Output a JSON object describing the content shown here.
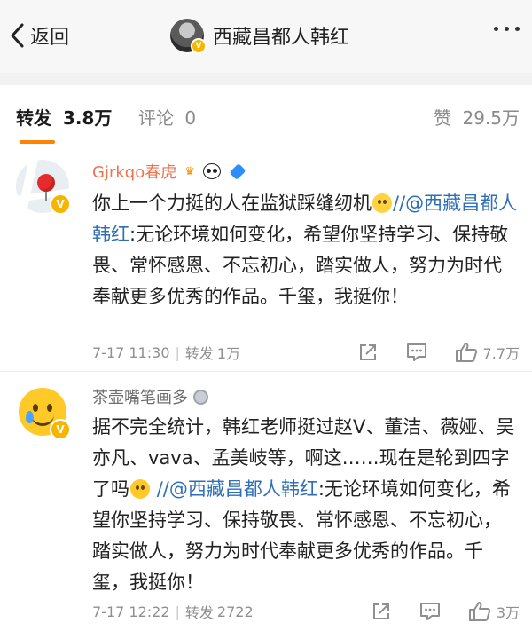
{
  "nav": {
    "back_label": "返回",
    "title": "西藏昌都人韩红"
  },
  "tabs": {
    "repost_label": "转发",
    "repost_count": "3.8万",
    "comment_label": "评论",
    "comment_count": "0",
    "like_label": "赞",
    "like_count": "29.5万"
  },
  "reposts": [
    {
      "username": "Gjrkqo春虎",
      "text_before": "你上一个力挺的人在监狱踩缝纫机",
      "mention": "//@西藏昌都人韩红",
      "text_after": ":无论环境如何变化，希望你坚持学习、保持敬畏、常怀感恩、不忘初心，踏实做人，努力为时代奉献更多优秀的作品。千玺，我挺你！",
      "time": "7-17 11:30",
      "repost_label": "转发",
      "repost_count": "1万",
      "like_count": "7.7万"
    },
    {
      "username": "茶壶嘴笔画多",
      "text_before": "据不完全统计，韩红老师挺过赵V、董洁、薇娅、吴亦凡、vava、孟美岐等，啊这……现在是轮到四字了吗",
      "mention": "//@西藏昌都人韩红",
      "text_after": ":无论环境如何变化，希望你坚持学习、保持敬畏、常怀感恩、不忘初心，踏实做人，努力为时代奉献更多优秀的作品。千玺，我挺你！",
      "time": "7-17 12:22",
      "repost_label": "转发",
      "repost_count": "2722",
      "like_count": "3万"
    }
  ],
  "colors": {
    "accent_orange": "#ff8200",
    "username_orange": "#eb7350",
    "link_blue": "#2f6fb7",
    "meta_gray": "#8f8f8f"
  },
  "icons": {
    "back": "chevron-left-icon",
    "more": "more-dots-icon",
    "verified": "verified-badge-icon",
    "share": "share-icon",
    "comment": "comment-icon",
    "like": "thumbs-up-icon"
  }
}
